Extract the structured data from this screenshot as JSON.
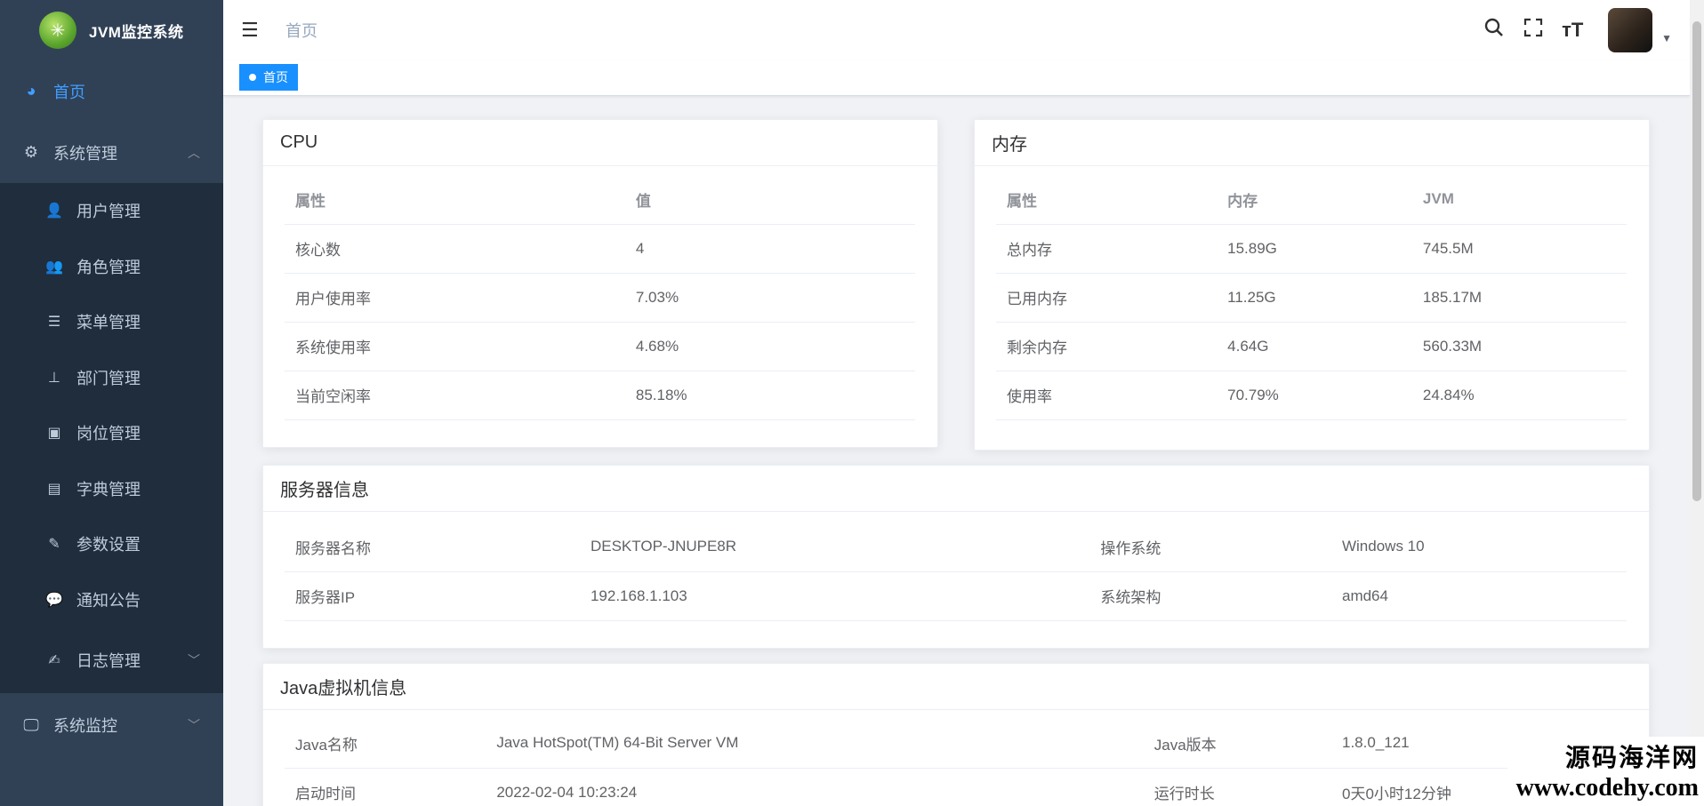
{
  "app": {
    "title": "JVM监控系统"
  },
  "sidebar": {
    "home": "首页",
    "system_mgmt": "系统管理",
    "items": [
      {
        "label": "用户管理",
        "icon": "user-icon"
      },
      {
        "label": "角色管理",
        "icon": "peoples-icon"
      },
      {
        "label": "菜单管理",
        "icon": "tree-table-icon"
      },
      {
        "label": "部门管理",
        "icon": "tree-icon"
      },
      {
        "label": "岗位管理",
        "icon": "post-icon"
      },
      {
        "label": "字典管理",
        "icon": "dict-icon"
      },
      {
        "label": "参数设置",
        "icon": "edit-icon"
      },
      {
        "label": "通知公告",
        "icon": "message-icon"
      },
      {
        "label": "日志管理",
        "icon": "log-icon"
      }
    ],
    "system_monitor": "系统监控"
  },
  "navbar": {
    "breadcrumb": "首页"
  },
  "tags": {
    "active": "首页"
  },
  "cpu": {
    "title": "CPU",
    "headers": [
      "属性",
      "值"
    ],
    "rows": [
      [
        "核心数",
        "4"
      ],
      [
        "用户使用率",
        "7.03%"
      ],
      [
        "系统使用率",
        "4.68%"
      ],
      [
        "当前空闲率",
        "85.18%"
      ]
    ]
  },
  "memory": {
    "title": "内存",
    "headers": [
      "属性",
      "内存",
      "JVM"
    ],
    "rows": [
      [
        "总内存",
        "15.89G",
        "745.5M"
      ],
      [
        "已用内存",
        "11.25G",
        "185.17M"
      ],
      [
        "剩余内存",
        "4.64G",
        "560.33M"
      ],
      [
        "使用率",
        "70.79%",
        "24.84%"
      ]
    ]
  },
  "server": {
    "title": "服务器信息",
    "rows": [
      [
        "服务器名称",
        "DESKTOP-JNUPE8R",
        "操作系统",
        "Windows 10"
      ],
      [
        "服务器IP",
        "192.168.1.103",
        "系统架构",
        "amd64"
      ]
    ]
  },
  "jvm": {
    "title": "Java虚拟机信息",
    "rows": [
      [
        "Java名称",
        "Java HotSpot(TM) 64-Bit Server VM",
        "Java版本",
        "1.8.0_121"
      ],
      [
        "启动时间",
        "2022-02-04 10:23:24",
        "运行时长",
        "0天0小时12分钟"
      ]
    ]
  },
  "watermark": {
    "line1": "源码海洋网",
    "line2": "www.codehy.com"
  }
}
